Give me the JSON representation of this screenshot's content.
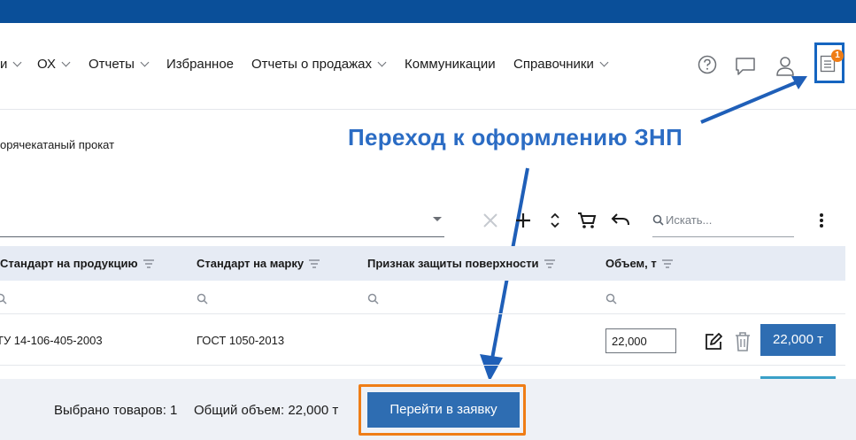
{
  "colors": {
    "brand": "#0a4f99",
    "accent": "#2e6db2",
    "annotation": "#2b6cc4",
    "highlight_orange": "#ef7d16",
    "badge": "#ef7d16"
  },
  "nav": {
    "items": [
      {
        "label": "и",
        "has_chevron": true
      },
      {
        "label": "ОХ",
        "has_chevron": true
      },
      {
        "label": "Отчеты",
        "has_chevron": true
      },
      {
        "label": "Избранное",
        "has_chevron": false
      },
      {
        "label": "Отчеты о продажах",
        "has_chevron": true
      },
      {
        "label": "Коммуникации",
        "has_chevron": false
      },
      {
        "label": "Справочники",
        "has_chevron": true
      }
    ],
    "icons": [
      "help-icon",
      "chat-icon",
      "user-icon",
      "order-list-icon"
    ],
    "badge_count": "1"
  },
  "breadcrumb": "орячекатаный прокат",
  "toolbar": {
    "search_placeholder": "Искать...",
    "icons": [
      "clear-icon",
      "add-icon",
      "sort-icon",
      "cart-icon",
      "undo-icon",
      "search-icon",
      "more-icon"
    ]
  },
  "table": {
    "columns": [
      "Стандарт на продукцию",
      "Стандарт на марку",
      "Признак защиты поверхности",
      "Объем, т"
    ],
    "rows": [
      {
        "standard_product": "ТУ 14-106-405-2003",
        "standard_grade": "ГОСТ 1050-2013",
        "surface_protection": "",
        "volume": "22,000",
        "volume_button": "22,000 т"
      }
    ]
  },
  "footer": {
    "selected_label": "Выбрано товаров: 1",
    "total_label": "Общий объем: 22,000 т",
    "go_button": "Перейти в заявку"
  },
  "annotation": {
    "text": "Переход к оформлению ЗНП"
  }
}
